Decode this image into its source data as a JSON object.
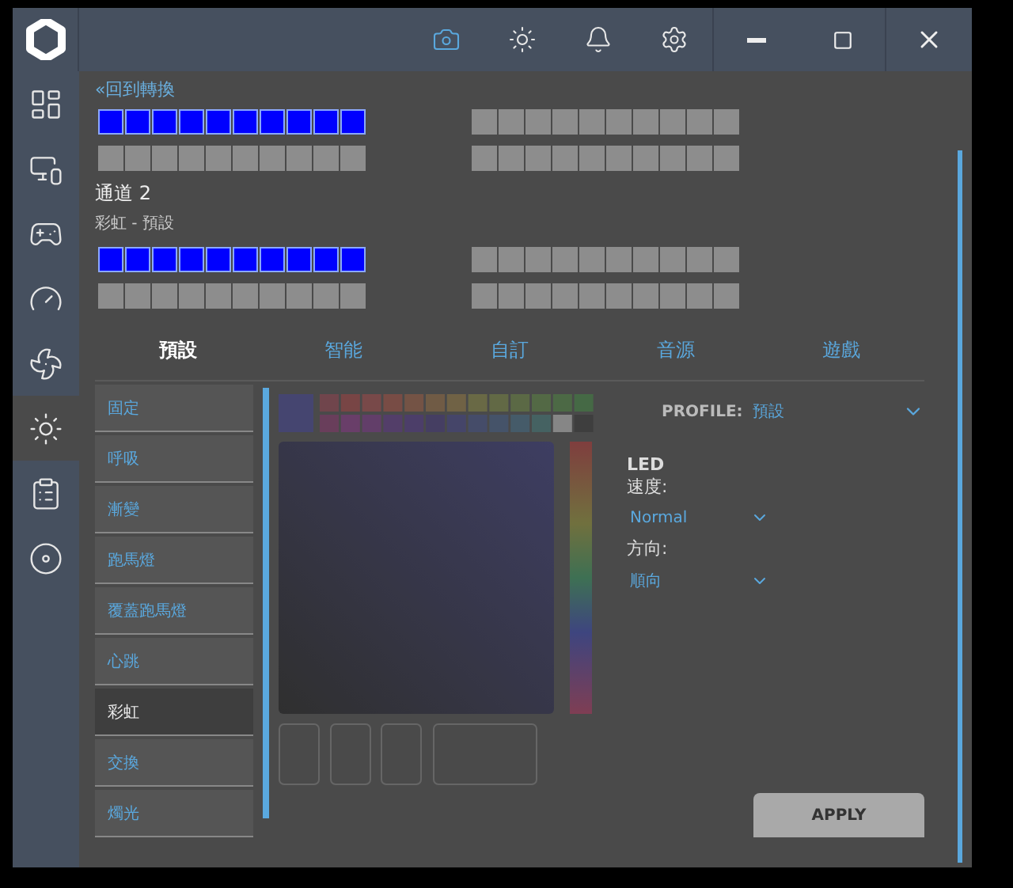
{
  "header": {
    "icons": [
      {
        "kind": "camera",
        "selected": true
      },
      {
        "kind": "sun",
        "selected": false
      },
      {
        "kind": "bell",
        "selected": false
      },
      {
        "kind": "gear",
        "selected": false
      }
    ]
  },
  "sidebar": {
    "items": [
      {
        "kind": "dashboard",
        "selected": false
      },
      {
        "kind": "monitor",
        "selected": false
      },
      {
        "kind": "gamepad",
        "selected": false
      },
      {
        "kind": "gauge",
        "selected": false
      },
      {
        "kind": "fan",
        "selected": false
      },
      {
        "kind": "sun",
        "selected": true
      },
      {
        "kind": "clipboard",
        "selected": false
      },
      {
        "kind": "disc",
        "selected": false
      }
    ]
  },
  "back_link": "«回到轉換",
  "channels": [
    {
      "zones": [
        {
          "lit": true
        },
        {
          "lit": false
        },
        {
          "lit": false
        },
        {
          "lit": false
        }
      ]
    },
    {
      "title": "通道 2",
      "subtitle": "彩虹 - 預設",
      "zones": [
        {
          "lit": true
        },
        {
          "lit": false
        },
        {
          "lit": false
        },
        {
          "lit": false
        }
      ]
    }
  ],
  "tabs": [
    {
      "label": "預設",
      "selected": true
    },
    {
      "label": "智能",
      "selected": false
    },
    {
      "label": "自訂",
      "selected": false
    },
    {
      "label": "音源",
      "selected": false
    },
    {
      "label": "遊戲",
      "selected": false
    }
  ],
  "effects": [
    {
      "label": "固定",
      "selected": false
    },
    {
      "label": "呼吸",
      "selected": false
    },
    {
      "label": "漸變",
      "selected": false
    },
    {
      "label": "跑馬燈",
      "selected": false
    },
    {
      "label": "覆蓋跑馬燈",
      "selected": false
    },
    {
      "label": "心跳",
      "selected": false
    },
    {
      "label": "彩虹",
      "selected": true
    },
    {
      "label": "交換",
      "selected": false
    },
    {
      "label": "燭光",
      "selected": false
    }
  ],
  "profile": {
    "label": "PROFILE:",
    "value": "預設"
  },
  "led": {
    "title": "LED",
    "speed_label": "速度:",
    "speed": "Normal",
    "direction_label": "方向:",
    "direction": "順向"
  },
  "apply": "APPLY"
}
